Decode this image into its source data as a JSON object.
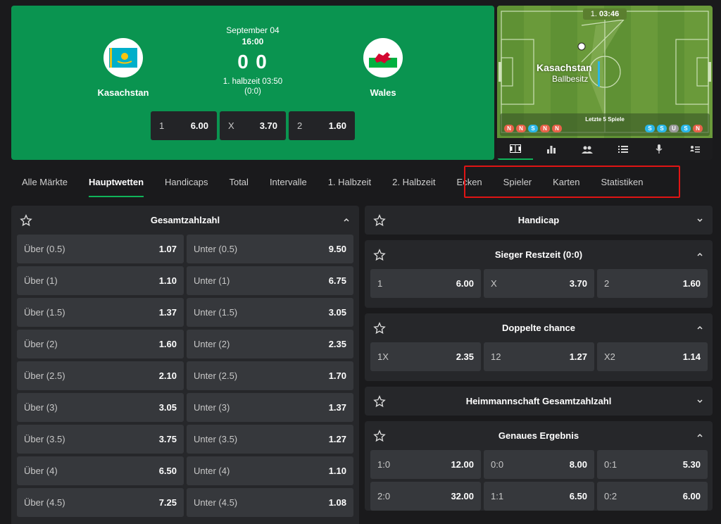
{
  "match": {
    "home_team": "Kasachstan",
    "away_team": "Wales",
    "date": "September 04",
    "time": "16:00",
    "score_home": "0",
    "score_away": "0",
    "period": "1. halbzeit 03:50",
    "halftime_score": "(0:0)",
    "odds": [
      {
        "label": "1",
        "value": "6.00"
      },
      {
        "label": "X",
        "value": "3.70"
      },
      {
        "label": "2",
        "value": "1.60"
      }
    ]
  },
  "field": {
    "period": "1.",
    "clock": "03:46",
    "possession_team": "Kasachstan",
    "possession_label": "Ballbesitz",
    "last5_label": "Letzte 5 Spiele",
    "home_form": [
      "N",
      "N",
      "S",
      "N",
      "N"
    ],
    "away_form": [
      "S",
      "S",
      "U",
      "S",
      "N"
    ],
    "tabs": [
      "pitch-icon",
      "stats-bars-icon",
      "lineup-icon",
      "list-icon",
      "microphone-icon",
      "standings-icon"
    ]
  },
  "tabs": [
    "Alle Märkte",
    "Hauptwetten",
    "Handicaps",
    "Total",
    "Intervalle",
    "1. Halbzeit",
    "2. Halbzeit",
    "Ecken",
    "Spieler",
    "Karten",
    "Statistiken"
  ],
  "active_tab": "Hauptwetten",
  "total_goals": {
    "title": "Gesamtzahlzahl",
    "rows": [
      {
        "over": "Über (0.5)",
        "over_odd": "1.07",
        "under": "Unter (0.5)",
        "under_odd": "9.50"
      },
      {
        "over": "Über (1)",
        "over_odd": "1.10",
        "under": "Unter (1)",
        "under_odd": "6.75"
      },
      {
        "over": "Über (1.5)",
        "over_odd": "1.37",
        "under": "Unter (1.5)",
        "under_odd": "3.05"
      },
      {
        "over": "Über (2)",
        "over_odd": "1.60",
        "under": "Unter (2)",
        "under_odd": "2.35"
      },
      {
        "over": "Über (2.5)",
        "over_odd": "2.10",
        "under": "Unter (2.5)",
        "under_odd": "1.70"
      },
      {
        "over": "Über (3)",
        "over_odd": "3.05",
        "under": "Unter (3)",
        "under_odd": "1.37"
      },
      {
        "over": "Über (3.5)",
        "over_odd": "3.75",
        "under": "Unter (3.5)",
        "under_odd": "1.27"
      },
      {
        "over": "Über (4)",
        "over_odd": "6.50",
        "under": "Unter (4)",
        "under_odd": "1.10"
      },
      {
        "over": "Über (4.5)",
        "over_odd": "7.25",
        "under": "Unter (4.5)",
        "under_odd": "1.08"
      }
    ]
  },
  "right_markets": {
    "handicap": {
      "title": "Handicap"
    },
    "rest_time": {
      "title": "Sieger Restzeit (0:0)",
      "cells": [
        {
          "label": "1",
          "value": "6.00"
        },
        {
          "label": "X",
          "value": "3.70"
        },
        {
          "label": "2",
          "value": "1.60"
        }
      ]
    },
    "double_chance": {
      "title": "Doppelte chance",
      "cells": [
        {
          "label": "1X",
          "value": "2.35"
        },
        {
          "label": "12",
          "value": "1.27"
        },
        {
          "label": "X2",
          "value": "1.14"
        }
      ]
    },
    "home_total": {
      "title": "Heimmannschaft Gesamtzahlzahl"
    },
    "exact_score": {
      "title": "Genaues Ergebnis",
      "cells": [
        {
          "label": "1:0",
          "value": "12.00"
        },
        {
          "label": "0:0",
          "value": "8.00"
        },
        {
          "label": "0:1",
          "value": "5.30"
        },
        {
          "label": "2:0",
          "value": "32.00"
        },
        {
          "label": "1:1",
          "value": "6.50"
        },
        {
          "label": "0:2",
          "value": "6.00"
        }
      ]
    }
  },
  "colors": {
    "match_green": "#0a9450",
    "accent_green": "#10b45a",
    "highlight_red": "#e01414",
    "background": "#1a1a1c",
    "card": "#26272a",
    "cell": "#36383c"
  }
}
